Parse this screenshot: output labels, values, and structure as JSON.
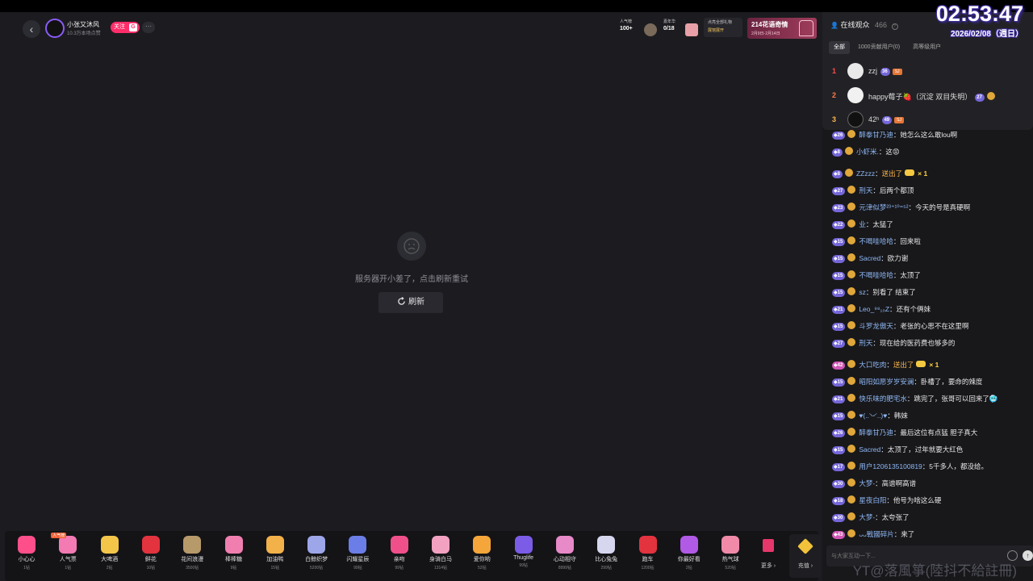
{
  "overlay": {
    "clock": "02:53:47",
    "date": "2026/02/08（週日）",
    "watermark": "YT@落風箏(陸抖不給註冊)"
  },
  "header": {
    "back_icon": "chevron-left-icon",
    "anchor_name": "小张又沐风",
    "anchor_sub": "10.3万本场点赞",
    "follow_label": "关注",
    "follow_badge": "G",
    "more_label": "···"
  },
  "stats": {
    "popularity_label": "人气榜",
    "popularity_value": "100+",
    "yearly_label": "嘉年华",
    "yearly_value": "0/18",
    "gift_ad_line1": "点亮全部礼物",
    "gift_ad_line2": "展馆展开",
    "banner_title": "214花语奇情",
    "banner_dates": "2月9日-2月14日"
  },
  "center": {
    "error_message": "服务器开小差了，点击刷新重试",
    "refresh_label": "刷新"
  },
  "gifts": [
    {
      "name": "小心心",
      "price": "1钻",
      "color": "#ff4f8b"
    },
    {
      "name": "人气票",
      "price": "1钻",
      "color": "#f37ab3",
      "tag": "人气榜"
    },
    {
      "name": "大啤酒",
      "price": "2钻",
      "color": "#f3c64a"
    },
    {
      "name": "鲜花",
      "price": "10钻",
      "color": "#e2333f"
    },
    {
      "name": "花间浪漫",
      "price": "3500钻",
      "color": "#b79a6a"
    },
    {
      "name": "棒棒糖",
      "price": "9钻",
      "color": "#f07fb0"
    },
    {
      "name": "加油鸭",
      "price": "15钻",
      "color": "#f3b14a"
    },
    {
      "name": "白鲸织梦",
      "price": "5200钻",
      "color": "#9da6e8"
    },
    {
      "name": "闪耀星辰",
      "price": "99钻",
      "color": "#6b7de6"
    },
    {
      "name": "亲吻",
      "price": "99钻",
      "color": "#f0508a"
    },
    {
      "name": "身骑白马",
      "price": "1314钻",
      "color": "#f2a1c0"
    },
    {
      "name": "爱你哟",
      "price": "52钻",
      "color": "#f5a63a"
    },
    {
      "name": "Thuglife",
      "price": "99钻",
      "color": "#7a5ce6"
    },
    {
      "name": "心动相守",
      "price": "8999钻",
      "color": "#e889c8"
    },
    {
      "name": "比心兔兔",
      "price": "299钻",
      "color": "#d6d6ef"
    },
    {
      "name": "跑车",
      "price": "1200钻",
      "color": "#e2333f"
    },
    {
      "name": "你最好看",
      "price": "2钻",
      "color": "#b15ae6"
    },
    {
      "name": "热气球",
      "price": "520钻",
      "color": "#f08aa8"
    }
  ],
  "gift_more_label": "更多",
  "gift_recharge_label": "充值",
  "audience": {
    "title": "在线观众",
    "count": "466",
    "help_icon": "question-icon",
    "tabs": [
      "全部",
      "1000贡献用户(0)",
      "高等级用户"
    ],
    "rows": [
      {
        "rank": "1",
        "name": "zzj",
        "level": "36",
        "fan": "SJ",
        "rank_color": "#ff4a4a",
        "avatar": "#e9e9e9"
      },
      {
        "rank": "2",
        "name": "happy莓子🍓（沉淀 双目失明）",
        "level": "27",
        "fan": "",
        "rank_color": "#ff7a4a",
        "avatar": "#f1f1f1"
      },
      {
        "rank": "3",
        "name": "42ʰ",
        "level": "49",
        "fan": "SJ",
        "rank_color": "#ffb64a",
        "avatar": "#111111"
      }
    ]
  },
  "chat": [
    {
      "level": "26",
      "user": "醉拳甘乃迪",
      "text": "她怎么这么敢lou啊",
      "gap": false
    },
    {
      "level": "8",
      "user": "小虾米.",
      "text": "这😡",
      "gap": false
    },
    {
      "level": "8",
      "user": "ZZzzz",
      "gift": "送出了",
      "count": "× 1",
      "gap": true
    },
    {
      "level": "27",
      "user": "刑天",
      "text": "后两个都顶",
      "gap": false
    },
    {
      "level": "23",
      "user": "元津似梦²³⁺¹⁰⁼⁵²",
      "text": "今天的号是真硬啊",
      "gap": false
    },
    {
      "level": "22",
      "user": "业",
      "text": "太猛了",
      "gap": false
    },
    {
      "level": "15",
      "user": "不喝哇哈哈",
      "text": "回来啦",
      "gap": false
    },
    {
      "level": "15",
      "user": "Sacred",
      "text": "欧力谢",
      "gap": false
    },
    {
      "level": "15",
      "user": "不喝哇哈哈",
      "text": "太顶了",
      "gap": false
    },
    {
      "level": "15",
      "user": "sz",
      "text": "别看了 结束了",
      "gap": false
    },
    {
      "level": "21",
      "user": "Leo_⁹⁸₁₀Z",
      "text": "还有个俩妹",
      "gap": false
    },
    {
      "level": "15",
      "user": "斗罗龙傲天",
      "text": "老张的心思不在这里啊",
      "gap": false
    },
    {
      "level": "27",
      "user": "刑天",
      "text": "现在给的医药费也够多的",
      "gap": false
    },
    {
      "level": "42",
      "user": "大口吃肉",
      "gift": "送出了",
      "count": "× 1",
      "gap": true,
      "pink": true
    },
    {
      "level": "15",
      "user": "昭阳如愿岁岁安澜",
      "text": "卧槽了，要命的辣度",
      "gap": false
    },
    {
      "level": "21",
      "user": "快乐味的肥宅水",
      "text": "跳完了，张哥可以回来了🥶",
      "gap": false
    },
    {
      "level": "15",
      "user": "♥(..◝ᵕ◜..)♥",
      "text": "韩妹",
      "gap": false
    },
    {
      "level": "26",
      "user": "醉拳甘乃迪",
      "text": "最后这位有点猛 胆子真大",
      "gap": false
    },
    {
      "level": "15",
      "user": "Sacred",
      "text": "太顶了，过年就要大红色",
      "gap": false
    },
    {
      "level": "17",
      "user": "用户1206135100819",
      "text": "5千多人，都没给。",
      "gap": false
    },
    {
      "level": "30",
      "user": "大梦-",
      "text": "高谱啊高谱",
      "gap": false
    },
    {
      "level": "18",
      "user": "星夜白阳",
      "text": "他号为啥这么硬",
      "gap": false
    },
    {
      "level": "30",
      "user": "大梦-",
      "text": "太夸张了",
      "gap": false
    },
    {
      "level": "43",
      "user": "ᴗᴗ戰國碎片",
      "text": "来了",
      "gap": false,
      "pink": true
    }
  ],
  "input": {
    "placeholder": "与大家互动一下...",
    "emoji_icon": "smiley-icon",
    "send_icon": "arrow-up-icon"
  }
}
